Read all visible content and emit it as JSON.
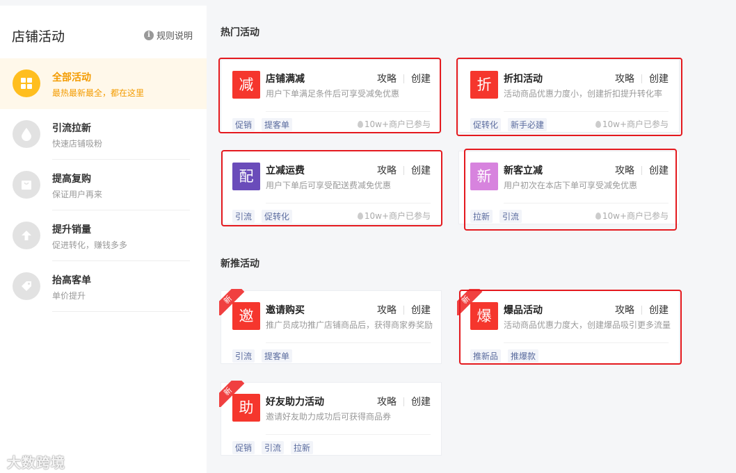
{
  "sidebar": {
    "title": "店铺活动",
    "rules_label": "规则说明",
    "items": [
      {
        "name": "全部活动",
        "desc": "最热最新最全，都在这里",
        "icon": "grid-icon"
      },
      {
        "name": "引流拉新",
        "desc": "快速店铺吸粉",
        "icon": "drop-icon"
      },
      {
        "name": "提高复购",
        "desc": "保证用户再来",
        "icon": "bag-icon"
      },
      {
        "name": "提升销量",
        "desc": "促进转化，赚钱多多",
        "icon": "arrow-up-icon"
      },
      {
        "name": "抬高客单",
        "desc": "单价提升",
        "icon": "tag-icon"
      }
    ]
  },
  "sections": {
    "hot_title": "热门活动",
    "new_title": "新推活动"
  },
  "common": {
    "strategy": "攻略",
    "create": "创建",
    "new_badge": "新"
  },
  "cards": [
    {
      "logo": "减",
      "color": "#f5362d",
      "name": "店铺满减",
      "desc": "用户下单满足条件后可享受减免优惠",
      "tags": [
        "促销",
        "提客单"
      ],
      "joined": "10w+商户已参与"
    },
    {
      "logo": "折",
      "color": "#f5362d",
      "name": "折扣活动",
      "desc": "活动商品优惠力度小，创建折扣提升转化率",
      "tags": [
        "促转化",
        "新手必建"
      ],
      "joined": "10w+商户已参与"
    },
    {
      "logo": "配",
      "color": "#6a4cba",
      "name": "立减运费",
      "desc": "用户下单后可享受配送费减免优惠",
      "tags": [
        "引流",
        "促转化"
      ],
      "joined": "10w+商户已参与"
    },
    {
      "logo": "新",
      "color": "#d783de",
      "name": "新客立减",
      "desc": "用户初次在本店下单可享受减免优惠",
      "tags": [
        "拉新",
        "引流"
      ],
      "joined": "10w+商户已参与"
    },
    {
      "logo": "邀",
      "color": "#f5362d",
      "name": "邀请购买",
      "desc": "推广员成功推广店铺商品后，获得商家券奖励",
      "tags": [
        "引流",
        "提客单"
      ],
      "joined": ""
    },
    {
      "logo": "爆",
      "color": "#f5362d",
      "name": "爆品活动",
      "desc": "活动商品优惠力度大，创建爆品吸引更多流量",
      "tags": [
        "推新品",
        "推爆款"
      ],
      "joined": ""
    },
    {
      "logo": "助",
      "color": "#f5362d",
      "name": "好友助力活动",
      "desc": "邀请好友助力成功后可获得商品券",
      "tags": [
        "促销",
        "引流",
        "拉新"
      ],
      "joined": ""
    }
  ],
  "watermark": "大数跨境"
}
